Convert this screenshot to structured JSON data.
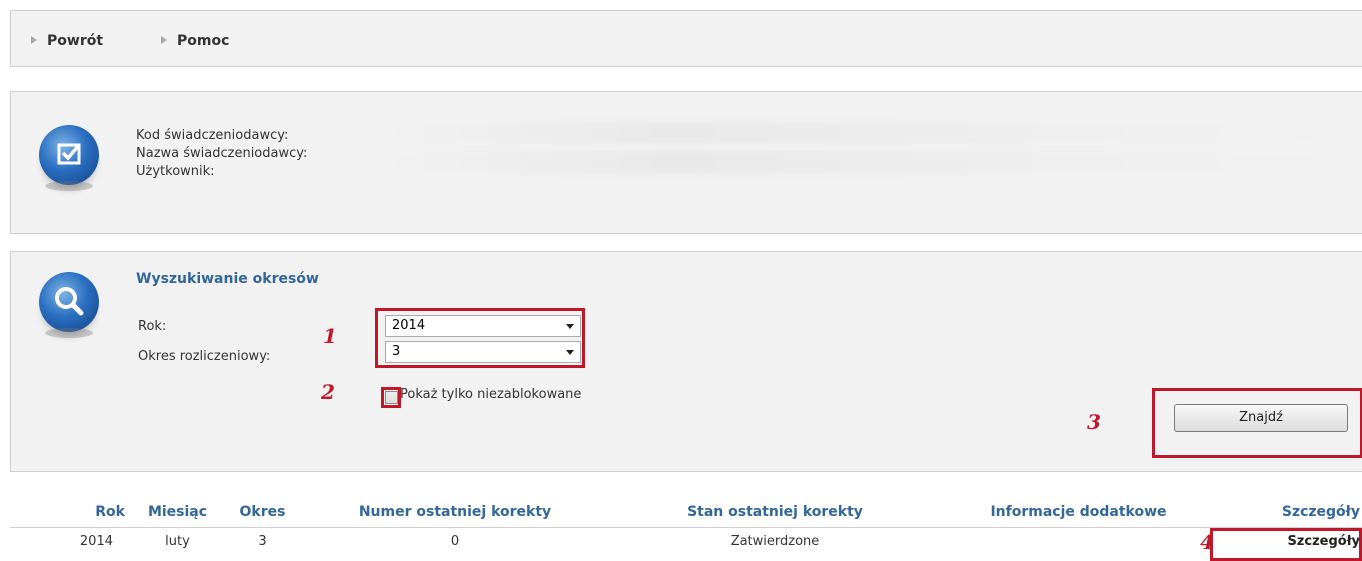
{
  "nav": {
    "items": [
      {
        "label": "Powrót"
      },
      {
        "label": "Pomoc"
      }
    ]
  },
  "provider": {
    "code_label": "Kod świadczeniodawcy:",
    "name_label": "Nazwa świadczeniodawcy:",
    "user_label": "Użytkownik:"
  },
  "search": {
    "title": "Wyszukiwanie okresów",
    "year_label": "Rok:",
    "year_value": "2014",
    "period_label": "Okres rozliczeniowy:",
    "period_value": "3",
    "checkbox_label": "Pokaż tylko niezablokowane",
    "checkbox_checked": false,
    "find_button": "Znajdź"
  },
  "annotations": {
    "n1": "1",
    "n2": "2",
    "n3": "3",
    "n4": "4",
    "color": "#c0182b"
  },
  "table": {
    "headers": [
      "Rok",
      "Miesiąc",
      "Okres",
      "Numer ostatniej korekty",
      "Stan ostatniej korekty",
      "Informacje dodatkowe",
      "Szczegóły"
    ],
    "rows": [
      {
        "rok": "2014",
        "miesiac": "luty",
        "okres": "3",
        "numer": "0",
        "stan": "Zatwierdzone",
        "info": "",
        "szczegoly": "Szczegóły"
      }
    ]
  },
  "colors": {
    "accent": "#336699",
    "panel_bg": "#f2f2f2",
    "highlight": "#c0182b"
  }
}
